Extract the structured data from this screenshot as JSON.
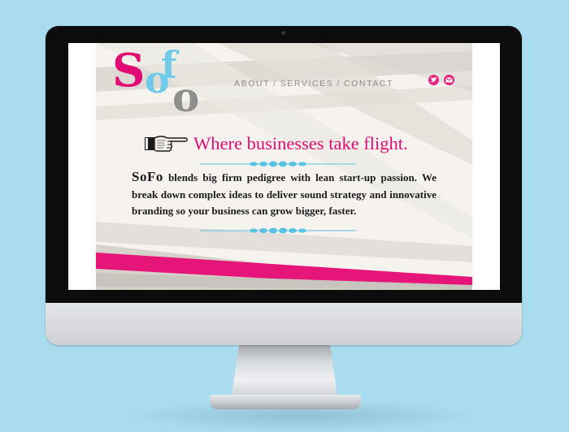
{
  "site": {
    "logo": {
      "letters": [
        "S",
        "o",
        "f",
        "o"
      ],
      "text": "SoFo",
      "colors": {
        "pink": "#e20b73",
        "blue": "#6fcbe9",
        "gray": "#8e8e8e"
      }
    },
    "nav": {
      "items": [
        "ABOUT",
        "SERVICES",
        "CONTACT"
      ],
      "separator": "/"
    },
    "social": [
      {
        "icon": "twitter-bird-icon",
        "color": "#e8257f"
      },
      {
        "icon": "envelope-icon",
        "color": "#e8257f"
      }
    ],
    "hero": {
      "pointer_icon": "pointing-hand-icon",
      "tagline": "Where businesses take flight.",
      "tagline_color": "#e20b73"
    },
    "intro": {
      "brand": "SoFo",
      "text": "blends big firm pedigree with lean start-up passion. We break down complex ideas to deliver sound strategy and innovative branding so your business can grow bigger, faster."
    },
    "accent_colors": {
      "divider": "#58c3e3",
      "band": "#e6157a",
      "stripes": "#dcd9d3"
    }
  },
  "device": {
    "type": "desktop-monitor",
    "frame_color": "#0c0c0c",
    "background": "#a9dcef"
  }
}
